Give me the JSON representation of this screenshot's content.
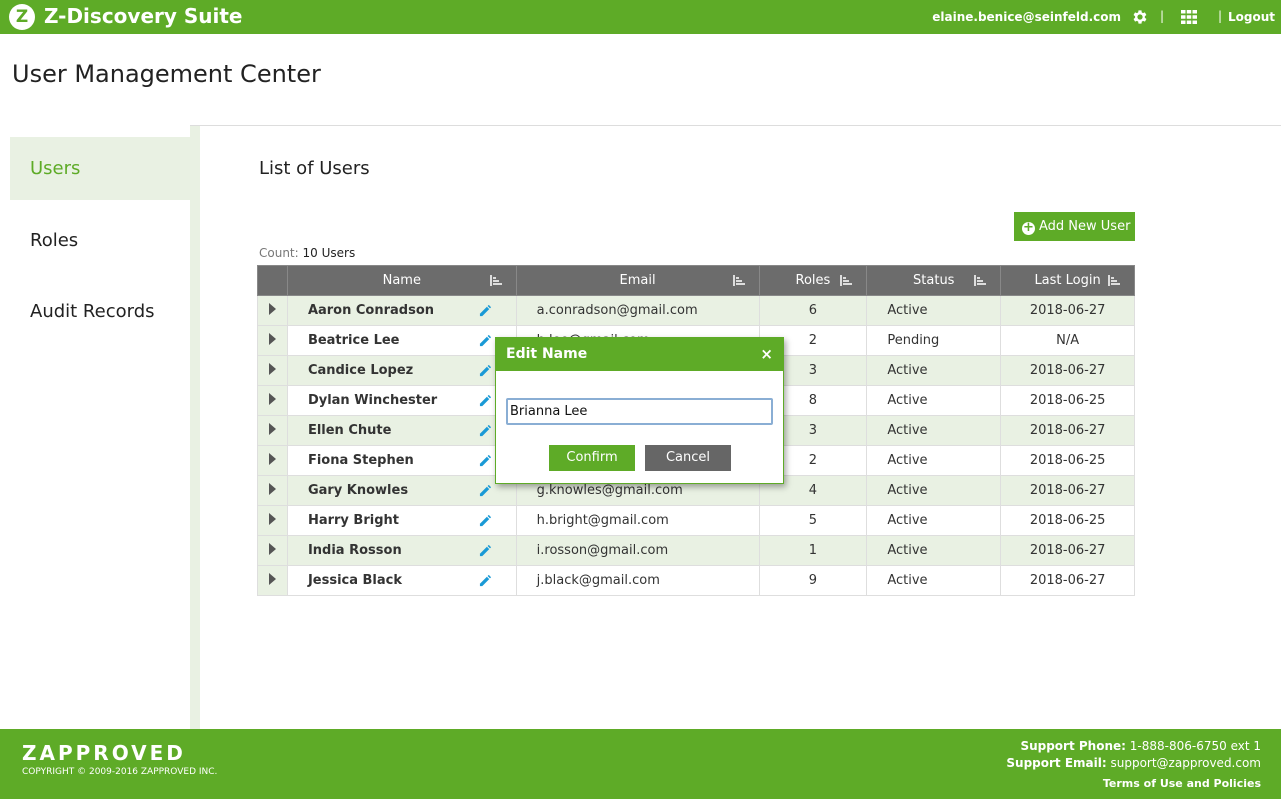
{
  "header": {
    "logo_letter": "Z",
    "app_title": "Z-Discovery Suite",
    "user_email": "elaine.benice@seinfeld.com",
    "separator": "|",
    "logout_label": "Logout"
  },
  "page_title": "User Management Center",
  "sidebar": {
    "items": [
      {
        "label": "Users",
        "active": true
      },
      {
        "label": "Roles",
        "active": false
      },
      {
        "label": "Audit Records",
        "active": false
      }
    ]
  },
  "main": {
    "section_title": "List of Users",
    "add_button_label": "Add New User",
    "count_label": "Count:",
    "count_value": "10 Users",
    "columns": [
      "Name",
      "Email",
      "Roles",
      "Status",
      "Last Login"
    ],
    "rows": [
      {
        "name": "Aaron Conradson",
        "email": "a.conradson@gmail.com",
        "roles": "6",
        "status": "Active",
        "last_login": "2018-06-27"
      },
      {
        "name": "Beatrice Lee",
        "email": "b.lee@gmail.com",
        "roles": "2",
        "status": "Pending",
        "last_login": "N/A"
      },
      {
        "name": "Candice Lopez",
        "email": "",
        "roles": "3",
        "status": "Active",
        "last_login": "2018-06-27"
      },
      {
        "name": "Dylan Winchester",
        "email": "",
        "roles": "8",
        "status": "Active",
        "last_login": "2018-06-25"
      },
      {
        "name": "Ellen Chute",
        "email": "",
        "roles": "3",
        "status": "Active",
        "last_login": "2018-06-27"
      },
      {
        "name": "Fiona Stephen",
        "email": "",
        "roles": "2",
        "status": "Active",
        "last_login": "2018-06-25"
      },
      {
        "name": "Gary Knowles",
        "email": "g.knowles@gmail.com",
        "roles": "4",
        "status": "Active",
        "last_login": "2018-06-27"
      },
      {
        "name": "Harry Bright",
        "email": "h.bright@gmail.com",
        "roles": "5",
        "status": "Active",
        "last_login": "2018-06-25"
      },
      {
        "name": "India Rosson",
        "email": "i.rosson@gmail.com",
        "roles": "1",
        "status": "Active",
        "last_login": "2018-06-27"
      },
      {
        "name": "Jessica Black",
        "email": "j.black@gmail.com",
        "roles": "9",
        "status": "Active",
        "last_login": "2018-06-27"
      }
    ]
  },
  "modal": {
    "title": "Edit Name",
    "close_icon": "×",
    "input_value": "Brianna Lee",
    "confirm_label": "Confirm",
    "cancel_label": "Cancel"
  },
  "footer": {
    "brand": "ZAPPROVED",
    "copyright": "COPYRIGHT © 2009-2016 ZAPPROVED INC.",
    "support_phone_label": "Support Phone:",
    "support_phone": "1-888-806-6750 ext 1",
    "support_email_label": "Support Email:",
    "support_email": "support@zapproved.com",
    "terms_label": "Terms of Use and Policies"
  },
  "colors": {
    "brand_green": "#5eab27",
    "row_alt": "#e9f1e3",
    "header_gray": "#6c6c6c",
    "cancel_gray": "#666666",
    "icon_blue": "#1a9ad6"
  },
  "icons": [
    "gear-icon",
    "apps-grid-icon",
    "plus-circle-icon",
    "sort-icon",
    "pencil-icon",
    "expand-arrow-icon",
    "close-icon"
  ]
}
